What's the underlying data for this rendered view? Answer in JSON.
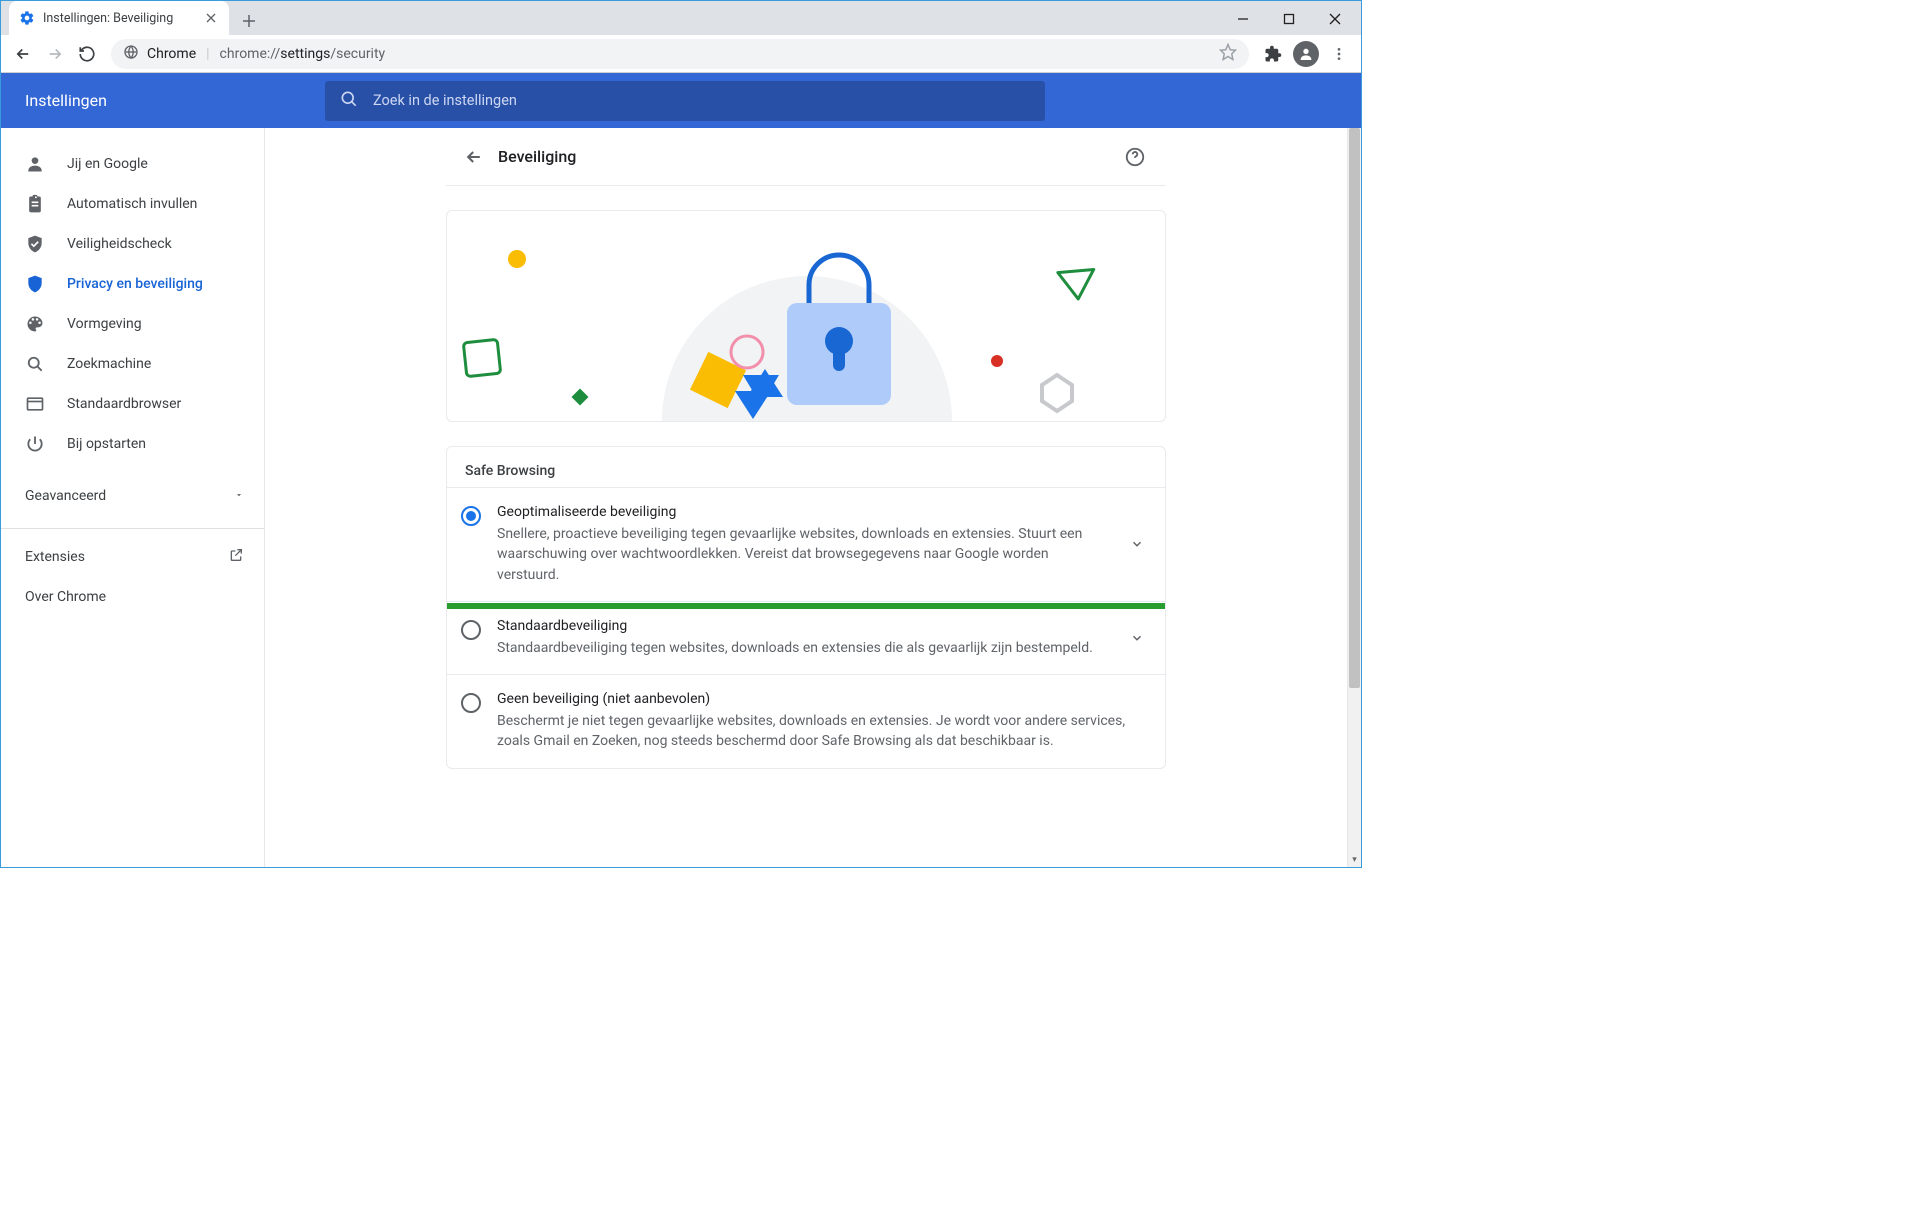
{
  "browser": {
    "tab_title": "Instellingen: Beveiliging",
    "omnibox_label": "Chrome",
    "omnibox_url_prefix": "chrome://",
    "omnibox_url_bold": "settings",
    "omnibox_url_suffix": "/security"
  },
  "header": {
    "title": "Instellingen",
    "search_placeholder": "Zoek in de instellingen"
  },
  "sidebar": {
    "items": [
      {
        "label": "Jij en Google"
      },
      {
        "label": "Automatisch invullen"
      },
      {
        "label": "Veiligheidscheck"
      },
      {
        "label": "Privacy en beveiliging"
      },
      {
        "label": "Vormgeving"
      },
      {
        "label": "Zoekmachine"
      },
      {
        "label": "Standaardbrowser"
      },
      {
        "label": "Bij opstarten"
      }
    ],
    "advanced": "Geavanceerd",
    "extensions": "Extensies",
    "about": "Over Chrome"
  },
  "page": {
    "title": "Beveiliging",
    "section": "Safe Browsing",
    "options": [
      {
        "title": "Geoptimaliseerde beveiliging",
        "desc": "Snellere, proactieve beveiliging tegen gevaarlijke websites, downloads en extensies. Stuurt een waarschuwing over wachtwoordlekken. Vereist dat browsegegevens naar Google worden verstuurd.",
        "checked": true,
        "expandable": true
      },
      {
        "title": "Standaardbeveiliging",
        "desc": "Standaardbeveiliging tegen websites, downloads en extensies die als gevaarlijk zijn bestempeld.",
        "checked": false,
        "expandable": true
      },
      {
        "title": "Geen beveiliging (niet aanbevolen)",
        "desc": "Beschermt je niet tegen gevaarlijke websites, downloads en extensies. Je wordt voor andere services, zoals Gmail en Zoeken, nog steeds beschermd door Safe Browsing als dat beschikbaar is.",
        "checked": false,
        "expandable": false
      }
    ]
  }
}
